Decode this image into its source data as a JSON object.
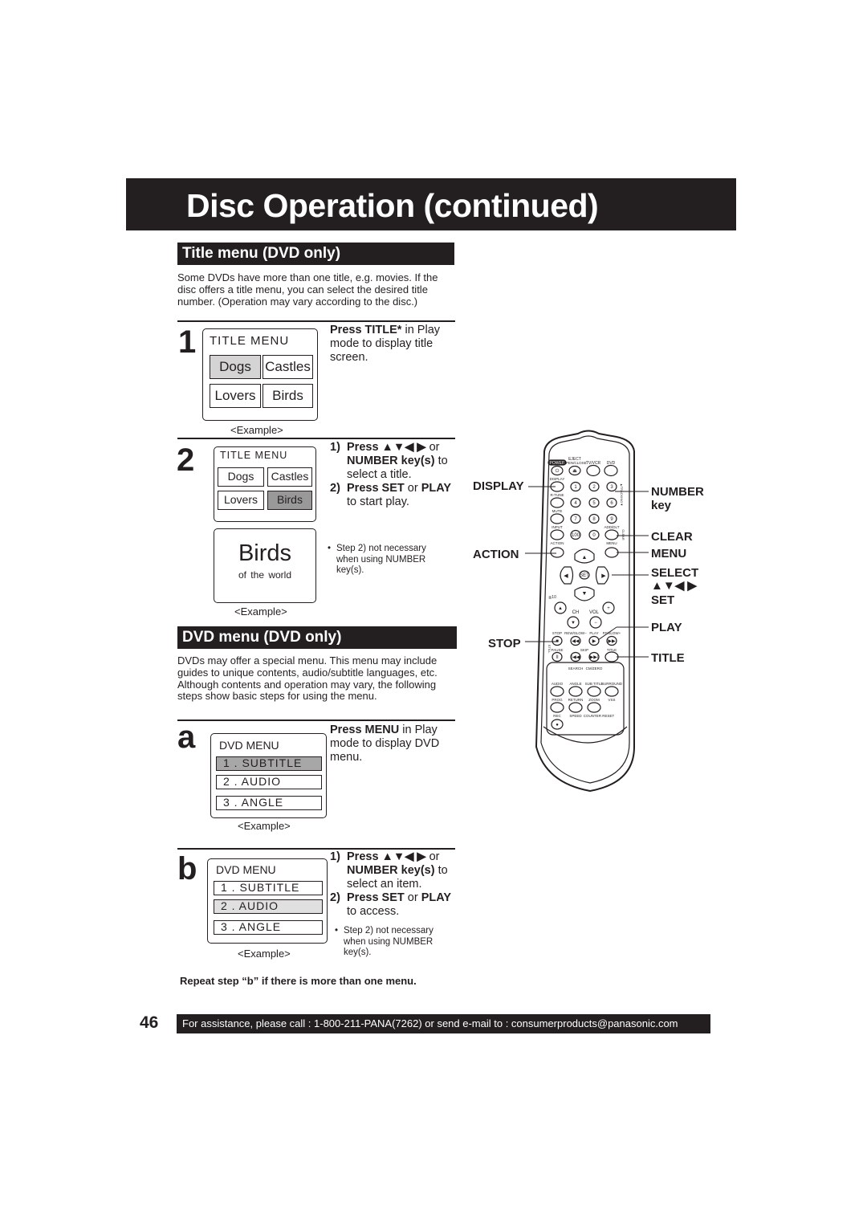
{
  "header": {
    "title": "Disc Operation (continued)"
  },
  "title_menu_section": {
    "heading": "Title menu (DVD only)",
    "intro": "Some DVDs have more than one title, e.g. movies. If the disc offers a title menu, you can select the desired title number. (Operation may vary according to the disc.)",
    "step1": {
      "number": "1",
      "screen": {
        "title": "TITLE MENU",
        "items": [
          "Dogs",
          "Castles",
          "Lovers",
          "Birds"
        ],
        "selected": "Dogs"
      },
      "example_label": "<Example>",
      "instruction_bold": "Press TITLE*",
      "instruction_rest": " in Play mode to display title screen."
    },
    "step2": {
      "number": "2",
      "screen": {
        "title": "TITLE MENU",
        "items": [
          "Dogs",
          "Castles",
          "Lovers",
          "Birds"
        ],
        "selected": "Birds"
      },
      "result_screen": {
        "title": "Birds",
        "subtitle": "of the world"
      },
      "example_label": "<Example>",
      "instructions": [
        {
          "num": "1)",
          "bold1": "Press ▲▼◀ ▶",
          "text1": " or ",
          "bold2": "NUMBER key(s)",
          "text2": " to select a title."
        },
        {
          "num": "2)",
          "bold1": "Press SET",
          "text1": " or ",
          "bold2": "PLAY",
          "text2": " to start play."
        }
      ],
      "note": "Step 2) not necessary when using NUMBER key(s)."
    }
  },
  "dvd_menu_section": {
    "heading": "DVD menu (DVD only)",
    "intro": "DVDs may offer a special menu. This menu may include guides to unique contents, audio/subtitle languages, etc. Although contents and operation may vary, the following steps show basic steps for using the menu.",
    "step_a": {
      "letter": "a",
      "screen": {
        "title": "DVD MENU",
        "items": [
          "1 . SUBTITLE",
          "2 . AUDIO",
          "3 . ANGLE"
        ],
        "selected": "1 . SUBTITLE"
      },
      "example_label": "<Example>",
      "instruction_bold": "Press MENU",
      "instruction_rest": " in Play mode to display DVD menu."
    },
    "step_b": {
      "letter": "b",
      "screen": {
        "title": "DVD MENU",
        "items": [
          "1 . SUBTITLE",
          "2 . AUDIO",
          "3 . ANGLE"
        ],
        "selected": "2 . AUDIO"
      },
      "example_label": "<Example>",
      "instructions": [
        {
          "num": "1)",
          "bold1": "Press ▲▼◀ ▶",
          "text1": " or ",
          "bold2": "NUMBER key(s)",
          "text2": " to select an item."
        },
        {
          "num": "2)",
          "bold1": "Press SET",
          "text1": " or ",
          "bold2": "PLAY",
          "text2": " to access."
        }
      ],
      "note": "Step 2) not necessary when using NUMBER key(s)."
    },
    "repeat_note": "Repeat step “b” if there is more than one menu."
  },
  "remote": {
    "callouts_left": [
      "DISPLAY",
      "ACTION",
      "STOP"
    ],
    "callouts_right": {
      "number": "NUMBER",
      "number_key": "key",
      "clear": "CLEAR",
      "menu": "MENU",
      "select": "SELECT",
      "arrows": "▲▼◀ ▶",
      "set": "SET",
      "play": "PLAY",
      "title": "TITLE"
    },
    "labels": {
      "power": "POWER",
      "eject": "EJECT",
      "open_close": "OPEN/CLOSE",
      "tv_vcr": "TV/VCR",
      "dvd": "DVD",
      "display": "DISPLAY",
      "r_tune": "R-TUNE",
      "mute": "MUTE",
      "input": "INPUT",
      "add_dlt": "ADD/DLT",
      "action": "ACTION",
      "menu": "MENU",
      "set": "SET",
      "ge10": "≧10",
      "ch": "CH",
      "vol": "VOL",
      "stop": "STOP",
      "rew": "REW/SLOW−",
      "play": "PLAY",
      "ff": "FF/SLOW+",
      "pause": "PAUSE",
      "skip": "SKIP",
      "title": "TITLE",
      "still": "STILL",
      "search": "SEARCH",
      "cm_zero": "CM/ZERO",
      "audio": "AUDIO",
      "angle": "ANGLE",
      "subtitle": "SUB TITLE",
      "surround": "SURROUND",
      "prog": "PROG",
      "return": "RETURN",
      "zoom": "ZOOM",
      "vss": "VSS",
      "rec": "REC",
      "speed": "SPEED",
      "counter_reset": "COUNTER RESET",
      "tracking": "▲TRACKING▼",
      "clear": "CLEAR",
      "digits": [
        "1",
        "2",
        "3",
        "4",
        "5",
        "6",
        "7",
        "8",
        "9",
        "100",
        "0"
      ]
    }
  },
  "footer": {
    "page_number": "46",
    "assistance": "For assistance, please call : 1-800-211-PANA(7262) or send e-mail to : consumerproducts@panasonic.com"
  }
}
